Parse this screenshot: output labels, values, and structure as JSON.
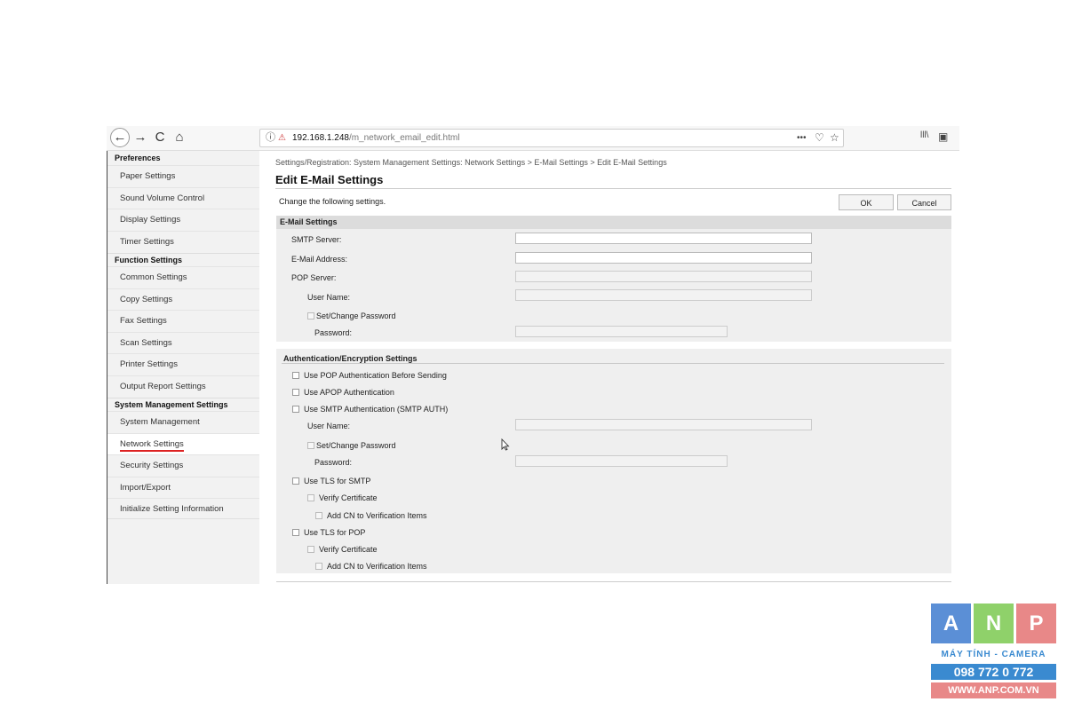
{
  "browser": {
    "url_host": "192.168.1.248",
    "url_path": "/m_network_email_edit.html",
    "icons": [
      "back-icon",
      "forward-icon",
      "reload-icon",
      "home-icon",
      "info-icon",
      "insecure-lock-icon",
      "more-icon",
      "pocket-icon",
      "bookmark-star-icon",
      "library-icon",
      "sidebar-icon"
    ],
    "glyphs": {
      "back": "←",
      "forward": "→",
      "reload": "C",
      "home": "⌂",
      "info": "ⓘ",
      "lock": "⚠",
      "more": "•••",
      "pocket": "♡",
      "star": "☆",
      "library": "lll\\",
      "sidebar": "▣"
    }
  },
  "sidebar": {
    "sections": [
      {
        "title": "Preferences",
        "items": [
          "Paper Settings",
          "Sound Volume Control",
          "Display Settings",
          "Timer Settings"
        ]
      },
      {
        "title": "Function Settings",
        "items": [
          "Common Settings",
          "Copy Settings",
          "Fax Settings",
          "Scan Settings",
          "Printer Settings",
          "Output Report Settings"
        ]
      },
      {
        "title": "System Management Settings",
        "items": [
          "System Management",
          "Network Settings",
          "Security Settings",
          "Import/Export",
          "Initialize Setting Information"
        ]
      }
    ],
    "active_item": "Network Settings"
  },
  "main": {
    "breadcrumb": "Settings/Registration: System Management Settings: Network Settings > E-Mail Settings > Edit E-Mail Settings",
    "title": "Edit E-Mail Settings",
    "instruction": "Change the following settings.",
    "ok_label": "OK",
    "cancel_label": "Cancel"
  },
  "email_settings": {
    "heading": "E-Mail Settings",
    "smtp_server": "SMTP Server:",
    "email_address": "E-Mail Address:",
    "pop_server": "POP Server:",
    "user_name": "User Name:",
    "set_change_password": "Set/Change Password",
    "password": "Password:"
  },
  "auth_settings": {
    "heading": "Authentication/Encryption Settings",
    "use_pop_auth": "Use POP Authentication Before Sending",
    "use_apop": "Use APOP Authentication",
    "use_smtp_auth": "Use SMTP Authentication (SMTP AUTH)",
    "user_name": "User Name:",
    "set_change_password": "Set/Change Password",
    "password": "Password:",
    "use_tls_smtp": "Use TLS for SMTP",
    "verify_cert_smtp": "Verify Certificate",
    "add_cn_smtp": "Add CN to Verification Items",
    "use_tls_pop": "Use TLS for POP",
    "verify_cert_pop": "Verify Certificate",
    "add_cn_pop": "Add CN to Verification Items"
  },
  "logo": {
    "letters": [
      "A",
      "N",
      "P"
    ],
    "colors": [
      "#5b8fd6",
      "#8fd16a",
      "#e88888"
    ],
    "tagline": "MÁY TÍNH - CAMERA",
    "phone": "098 772 0 772",
    "website": "WWW.ANP.COM.VN"
  }
}
